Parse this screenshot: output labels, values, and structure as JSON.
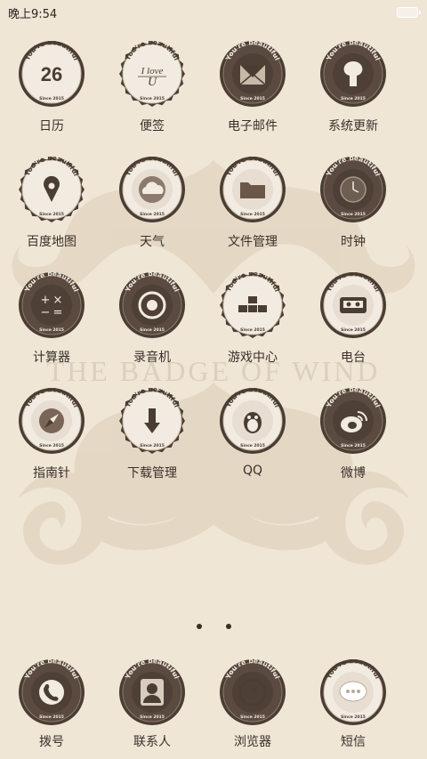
{
  "status_bar": {
    "time": "晚上9:54",
    "icons": [
      "battery-icon"
    ]
  },
  "wallpaper": {
    "text": "THE BADGE OF WIND"
  },
  "badge": {
    "arc_text": "You're beautiful",
    "since_text": "Since 2015",
    "calendar_day": "26",
    "note_text_1": "I love",
    "note_text_2": "U"
  },
  "apps": [
    {
      "label": "日历",
      "icon": "calendar-icon"
    },
    {
      "label": "便签",
      "icon": "notes-icon"
    },
    {
      "label": "电子邮件",
      "icon": "mail-icon"
    },
    {
      "label": "系统更新",
      "icon": "update-icon"
    },
    {
      "label": "百度地图",
      "icon": "map-pin-icon"
    },
    {
      "label": "天气",
      "icon": "cloud-icon"
    },
    {
      "label": "文件管理",
      "icon": "folder-icon"
    },
    {
      "label": "时钟",
      "icon": "clock-icon"
    },
    {
      "label": "计算器",
      "icon": "calculator-icon"
    },
    {
      "label": "录音机",
      "icon": "recorder-icon"
    },
    {
      "label": "游戏中心",
      "icon": "game-blocks-icon"
    },
    {
      "label": "电台",
      "icon": "radio-icon"
    },
    {
      "label": "指南针",
      "icon": "compass-icon"
    },
    {
      "label": "下载管理",
      "icon": "download-icon"
    },
    {
      "label": "QQ",
      "icon": "qq-icon"
    },
    {
      "label": "微博",
      "icon": "weibo-icon"
    }
  ],
  "dock": [
    {
      "label": "拨号",
      "icon": "phone-icon"
    },
    {
      "label": "联系人",
      "icon": "contacts-icon"
    },
    {
      "label": "浏览器",
      "icon": "browser-icon"
    },
    {
      "label": "短信",
      "icon": "message-icon"
    }
  ],
  "page_indicator": {
    "pages": 2,
    "current": 1
  },
  "colors": {
    "background": "#efe6d6",
    "badge_dark": "#4a3d33",
    "badge_light": "#f2ebe1",
    "text": "#3a3029"
  }
}
